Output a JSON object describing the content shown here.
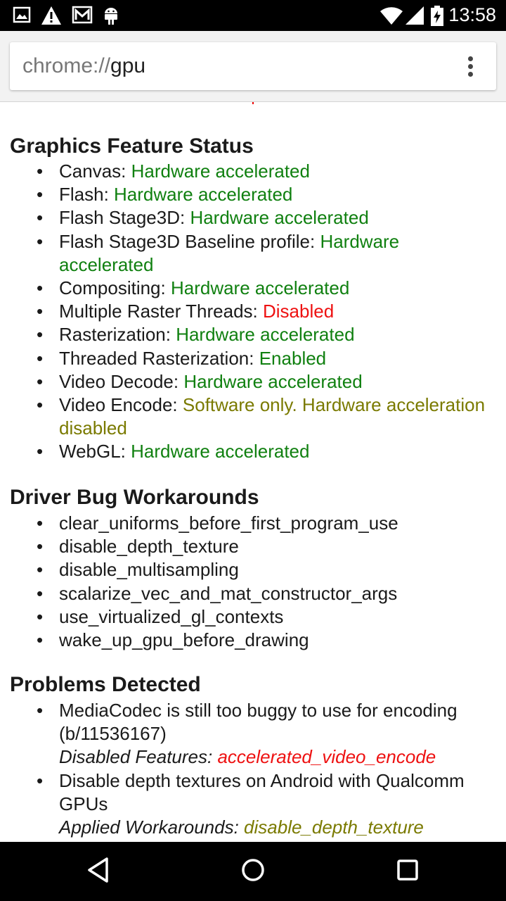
{
  "status_bar": {
    "time": "13:58",
    "icons": [
      "image-icon",
      "warning-icon",
      "gmail-icon",
      "android-icon",
      "wifi-icon",
      "signal-icon",
      "battery-charging-icon"
    ]
  },
  "browser": {
    "url_scheme": "chrome://",
    "url_host": "gpu",
    "menu_icon": "overflow-menu-icon"
  },
  "colors": {
    "enabled": "#108010",
    "disabled": "#ee1111",
    "software": "#7a7a00"
  },
  "sections": {
    "features": {
      "title": "Graphics Feature Status",
      "items": [
        {
          "name": "Canvas: ",
          "status": "Hardware accelerated"
        },
        {
          "name": "Flash: ",
          "status": "Hardware accelerated"
        },
        {
          "name": "Flash Stage3D: ",
          "status": "Hardware accelerated"
        },
        {
          "name": "Flash Stage3D Baseline profile: ",
          "status": "Hardware accelerated"
        },
        {
          "name": "Compositing: ",
          "status": "Hardware accelerated"
        },
        {
          "name": "Multiple Raster Threads: ",
          "status": "Disabled"
        },
        {
          "name": "Rasterization: ",
          "status": "Hardware accelerated"
        },
        {
          "name": "Threaded Rasterization: ",
          "status": "Enabled"
        },
        {
          "name": "Video Decode: ",
          "status": "Hardware accelerated"
        },
        {
          "name": "Video Encode: ",
          "status": "Software only. Hardware acceleration disabled"
        },
        {
          "name": "WebGL: ",
          "status": "Hardware accelerated"
        }
      ]
    },
    "workarounds": {
      "title": "Driver Bug Workarounds",
      "items": [
        "clear_uniforms_before_first_program_use",
        "disable_depth_texture",
        "disable_multisampling",
        "scalarize_vec_and_mat_constructor_args",
        "use_virtualized_gl_contexts",
        "wake_up_gpu_before_drawing"
      ]
    },
    "problems": {
      "title": "Problems Detected",
      "items": [
        {
          "text": "MediaCodec is still too buggy to use for encoding (b/11536167)",
          "label": "Disabled Features: ",
          "value": "accelerated_video_encode"
        },
        {
          "text": "Disable depth textures on Android with Qualcomm GPUs",
          "label": "Applied Workarounds: ",
          "value": "disable_depth_texture"
        }
      ]
    }
  },
  "nav_bar": {
    "buttons": [
      "back-icon",
      "home-icon",
      "recents-icon"
    ]
  }
}
